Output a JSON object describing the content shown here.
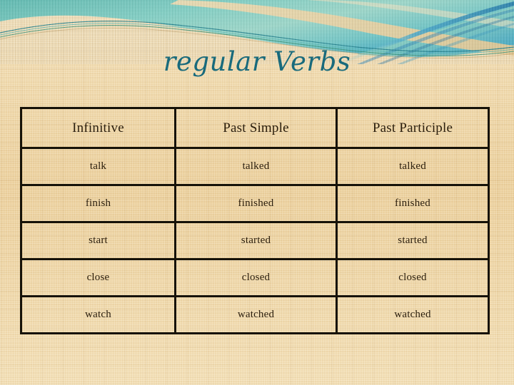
{
  "slide": {
    "title": "regular Verbs",
    "title_color": "#186a7c",
    "background_color": "#ecd2a0",
    "banner": {
      "name": "teal-wave-banner",
      "colors": {
        "teal_light": "#7fd0c6",
        "teal_mid": "#4fb3aa",
        "teal_deep": "#2f9d9a",
        "blue_accent": "#2f9bc4",
        "blue_deep": "#1c6f9e",
        "green_line": "#2f8f73",
        "ribbon_tan": "#edd4a4"
      }
    }
  },
  "table": {
    "name": "regular-verbs-table",
    "headers": [
      "Infinitive",
      "Past Simple",
      "Past Participle"
    ],
    "rows": [
      {
        "infinitive": "talk",
        "past_simple": "talked",
        "past_participle": "talked"
      },
      {
        "infinitive": "finish",
        "past_simple": "finished",
        "past_participle": "finished"
      },
      {
        "infinitive": "start",
        "past_simple": "started",
        "past_participle": "started"
      },
      {
        "infinitive": "close",
        "past_simple": "closed",
        "past_participle": "closed"
      },
      {
        "infinitive": "watch",
        "past_simple": "watched",
        "past_participle": "watched"
      }
    ],
    "border_color": "#161208",
    "text_color": "#2a1d0c"
  }
}
